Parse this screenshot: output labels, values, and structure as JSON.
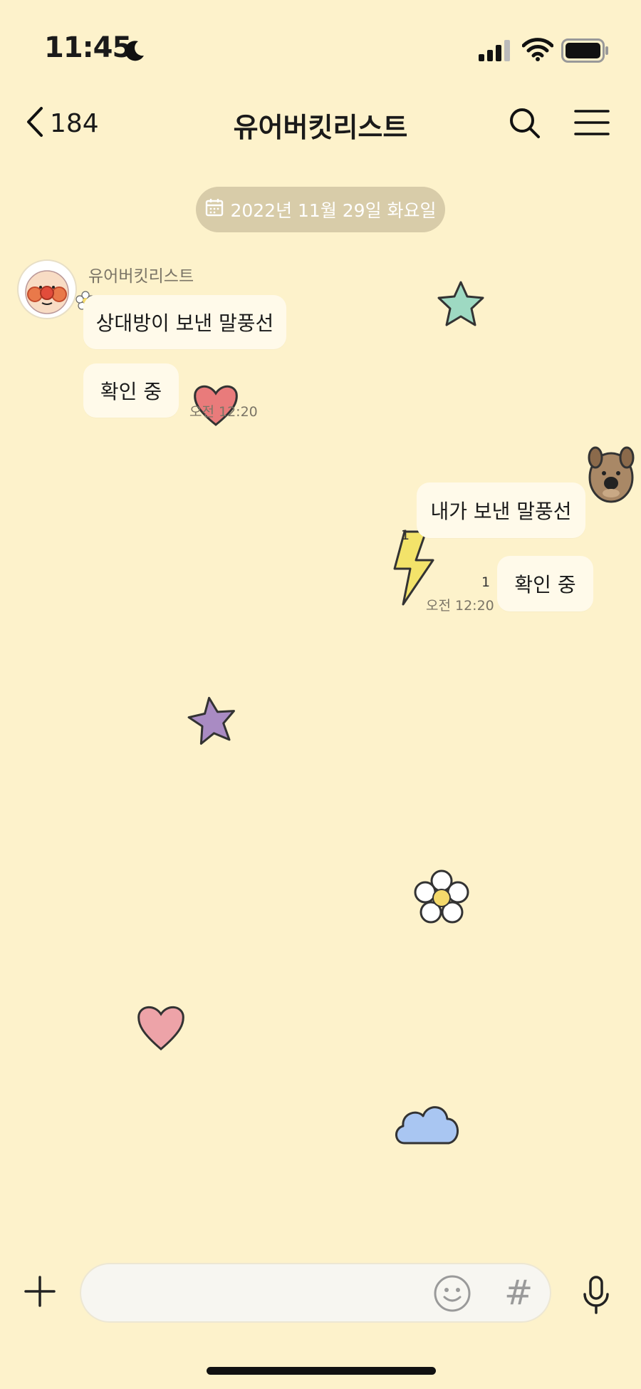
{
  "status_bar": {
    "time": "11:45",
    "moon_icon": "moon-icon",
    "signal_icon": "cellular-signal-icon",
    "wifi_icon": "wifi-icon",
    "battery_icon": "battery-icon"
  },
  "nav": {
    "back_icon": "chevron-left-icon",
    "back_count": "184",
    "title": "유어버킷리스트",
    "search_icon": "search-icon",
    "menu_icon": "hamburger-menu-icon"
  },
  "date_divider": {
    "icon": "calendar-icon",
    "label": "2022년 11월 29일 화요일"
  },
  "messages": {
    "incoming": {
      "sender": "유어버킷리스트",
      "bubbles": [
        "상대방이 보낸 말풍선",
        "확인 중"
      ],
      "time": "오전 12:20"
    },
    "outgoing": {
      "bubbles": [
        "내가 보낸 말풍선",
        "확인 중"
      ],
      "read_counts": [
        "1",
        "1"
      ],
      "time": "오전 12:20"
    }
  },
  "input_bar": {
    "plus_icon": "plus-icon",
    "placeholder": "",
    "emoji_icon": "emoji-icon",
    "hashtag_label": "#",
    "mic_icon": "microphone-icon"
  },
  "colors": {
    "background": "#FDF2CB",
    "bubble": "#FFFAEA",
    "date_pill": "#D8CCA9"
  }
}
